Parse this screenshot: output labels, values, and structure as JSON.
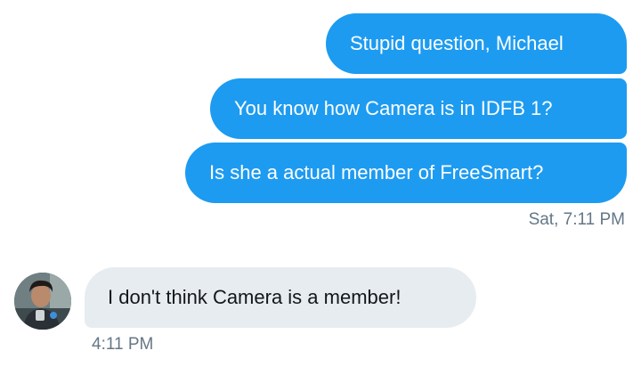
{
  "conversation": {
    "outgoing": [
      {
        "text": "Stupid question, Michael"
      },
      {
        "text": "You know how Camera is in IDFB 1?"
      },
      {
        "text": "Is she a actual member of FreeSmart?"
      }
    ],
    "outgoing_timestamp": "Sat, 7:11 PM",
    "incoming": [
      {
        "text": "I don't think Camera is a member!"
      }
    ],
    "incoming_timestamp": "4:11 PM"
  },
  "colors": {
    "outgoing_bubble": "#1d9bf0",
    "incoming_bubble": "#e6ecf0",
    "timestamp": "#657786"
  }
}
